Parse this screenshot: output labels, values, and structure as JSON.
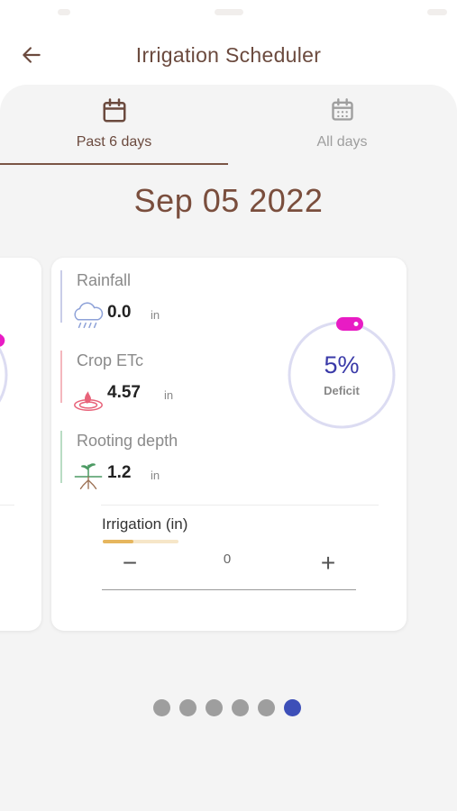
{
  "header": {
    "title": "Irrigation Scheduler",
    "back_icon": "arrow-left-icon"
  },
  "tabs": [
    {
      "label": "Past 6 days",
      "icon": "calendar-icon",
      "selected": true
    },
    {
      "label": "All days",
      "icon": "calendar-grid-icon",
      "selected": false
    }
  ],
  "date": "Sep 05 2022",
  "card": {
    "metrics": [
      {
        "label": "Rainfall",
        "value": "0.0",
        "unit": "in",
        "icon": "rain-cloud-icon",
        "accent": "#c9cde8"
      },
      {
        "label": "Crop ETc",
        "value": "4.57",
        "unit": "in",
        "icon": "evapotranspiration-icon",
        "accent": "#f4b7bd"
      },
      {
        "label": "Rooting depth",
        "value": "1.2",
        "unit": "in",
        "icon": "roots-icon",
        "accent": "#b9dcc4"
      }
    ],
    "deficit": {
      "percent": "5%",
      "label": "Deficit",
      "fraction": 0.05
    },
    "irrigation": {
      "label": "Irrigation (in)",
      "value": "0",
      "minus": "−",
      "plus": "+",
      "fill_fraction": 0.4
    }
  },
  "pager": {
    "count": 6,
    "active_index": 5
  },
  "colors": {
    "brand_brown": "#6b4a3e",
    "deficit_blue": "#3a3aa8",
    "gauge_ring": "#dcdcf2",
    "gauge_handle": "#e81cc4",
    "pager_active": "#3d4fb8",
    "pager_inactive": "#9e9e9e"
  }
}
